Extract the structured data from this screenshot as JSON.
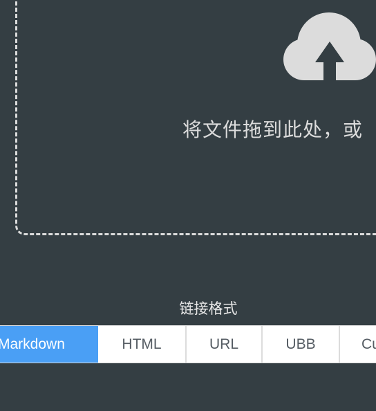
{
  "upload": {
    "drop_hint": "将文件拖到此处，或",
    "icon": "cloud-upload-icon"
  },
  "link_format": {
    "label": "链接格式",
    "tabs": [
      {
        "label": "Markdown",
        "active": true
      },
      {
        "label": "HTML",
        "active": false
      },
      {
        "label": "URL",
        "active": false
      },
      {
        "label": "UBB",
        "active": false
      },
      {
        "label": "Cu",
        "active": false
      }
    ]
  },
  "colors": {
    "background": "#343e43",
    "accent": "#4a9ff5",
    "dashed_border": "#dcdcdc"
  }
}
